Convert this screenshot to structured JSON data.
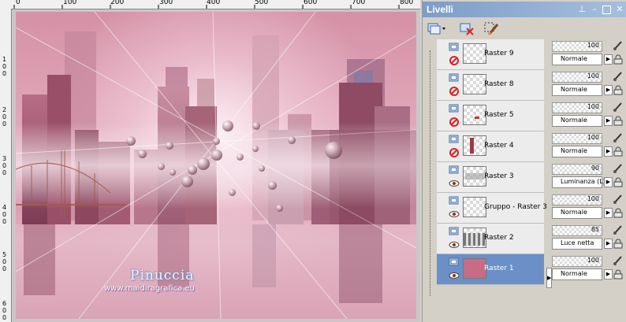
{
  "ruler": {
    "top_labels": [
      "0",
      "100",
      "200",
      "300",
      "400",
      "500",
      "600",
      "700",
      "800"
    ],
    "left_labels": [
      "1 0 0",
      "2 0 0",
      "3 0 0",
      "4 0 0",
      "5 0 0",
      "6 0 0"
    ]
  },
  "canvas": {
    "watermark_name": "Pinuccia",
    "watermark_url": "www.maidiragrafica.eu"
  },
  "panel": {
    "title": "Livelli",
    "title_buttons": [
      "pin-icon",
      "close-icon",
      "maximize-icon",
      "close-icon"
    ],
    "toolbar_icons": [
      "new-layer-icon",
      "delete-layer-icon",
      "edit-selection-icon"
    ],
    "layers": [
      {
        "name": "Raster 9",
        "opacity": "100",
        "blend": "Normale",
        "visible": false,
        "selected": false
      },
      {
        "name": "Raster 8",
        "opacity": "100",
        "blend": "Normale",
        "visible": false,
        "selected": false
      },
      {
        "name": "Raster 5",
        "opacity": "100",
        "blend": "Normale",
        "visible": false,
        "selected": false
      },
      {
        "name": "Raster 4",
        "opacity": "100",
        "blend": "Normale",
        "visible": false,
        "selected": false
      },
      {
        "name": "Raster 3",
        "opacity": "90",
        "blend": "Luminanza (L)",
        "visible": true,
        "selected": false
      },
      {
        "name": "Gruppo - Raster 3",
        "opacity": "100",
        "blend": "Normale",
        "visible": true,
        "selected": false
      },
      {
        "name": "Raster 2",
        "opacity": "85",
        "blend": "Luce netta",
        "visible": true,
        "selected": false
      },
      {
        "name": "Raster 1",
        "opacity": "100",
        "blend": "Normale",
        "visible": true,
        "selected": true
      }
    ]
  },
  "colors": {
    "title_bar": "#7d9dc6",
    "selected_row": "#6b8fc7",
    "canvas_tint": "#d89aad"
  }
}
